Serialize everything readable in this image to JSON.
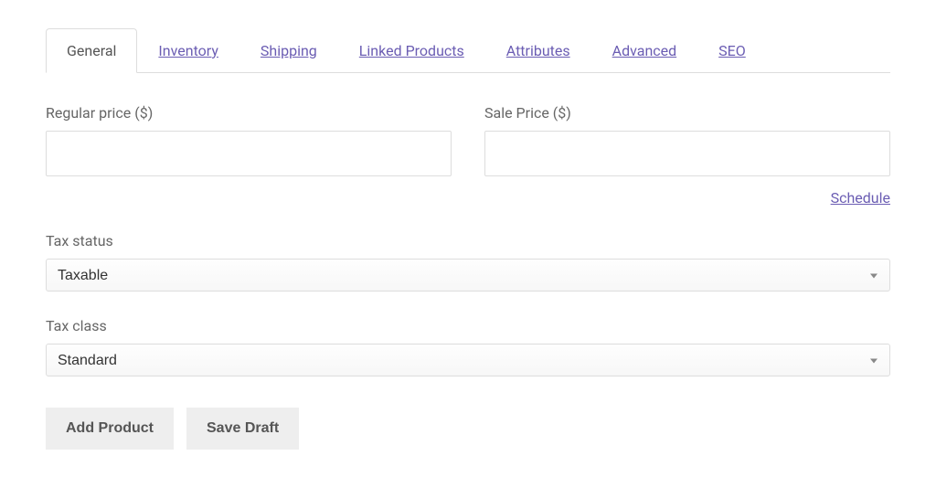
{
  "tabs": {
    "general": "General",
    "inventory": "Inventory",
    "shipping": "Shipping",
    "linked_products": "Linked Products",
    "attributes": "Attributes",
    "advanced": "Advanced",
    "seo": "SEO"
  },
  "fields": {
    "regular_price_label": "Regular price ($)",
    "regular_price_value": "",
    "sale_price_label": "Sale Price ($)",
    "sale_price_value": "",
    "schedule_link": "Schedule",
    "tax_status_label": "Tax status",
    "tax_status_value": "Taxable",
    "tax_class_label": "Tax class",
    "tax_class_value": "Standard"
  },
  "buttons": {
    "add_product": "Add Product",
    "save_draft": "Save Draft"
  }
}
